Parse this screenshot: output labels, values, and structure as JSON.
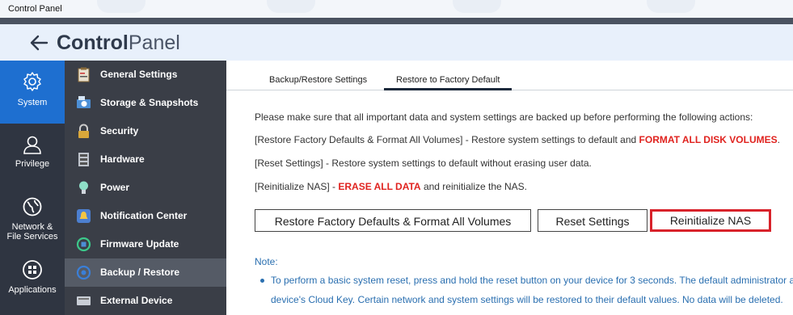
{
  "window": {
    "title": "Control Panel"
  },
  "header": {
    "title_bold": "Control",
    "title_rest": "Panel"
  },
  "rail": [
    {
      "label": "System",
      "icon": "gear-icon",
      "active": true
    },
    {
      "label": "Privilege",
      "icon": "user-icon"
    },
    {
      "label_line1": "Network &",
      "label_line2": "File Services",
      "icon": "globe-icon"
    },
    {
      "label": "Applications",
      "icon": "apps-grid-icon"
    }
  ],
  "submenu": [
    {
      "label": "General Settings",
      "icon": "clipboard-icon"
    },
    {
      "label": "Storage & Snapshots",
      "icon": "storage-icon"
    },
    {
      "label": "Security",
      "icon": "lock-icon"
    },
    {
      "label": "Hardware",
      "icon": "hardware-icon"
    },
    {
      "label": "Power",
      "icon": "bulb-icon"
    },
    {
      "label": "Notification Center",
      "icon": "notification-icon"
    },
    {
      "label": "Firmware Update",
      "icon": "firmware-icon"
    },
    {
      "label": "Backup / Restore",
      "icon": "backup-icon",
      "active": true
    },
    {
      "label": "External Device",
      "icon": "external-device-icon"
    }
  ],
  "tabs": [
    {
      "label": "Backup/Restore Settings"
    },
    {
      "label": "Restore to Factory Default",
      "active": true
    }
  ],
  "content": {
    "intro": "Please make sure that all important data and system settings are backed up before performing the following actions:",
    "line1_a": "[Restore Factory Defaults & Format All Volumes] - Restore system settings to default and ",
    "line1_red": "FORMAT ALL DISK VOLUMES",
    "line1_b": ".",
    "line2": "[Reset Settings] - Restore system settings to default without erasing user data.",
    "line3_a": "[Reinitialize NAS] - ",
    "line3_red": "ERASE ALL DATA",
    "line3_b": " and reinitialize the NAS."
  },
  "buttons": {
    "restore_format": "Restore Factory Defaults & Format All Volumes",
    "reset": "Reset Settings",
    "reinitialize": "Reinitialize NAS"
  },
  "note": {
    "title": "Note:",
    "line1": "To perform a basic system reset, press and hold the reset button on your device for 3 seconds. The default administrator a",
    "line2": "device's Cloud Key. Certain network and system settings will be restored to their default values. No data will be deleted."
  },
  "colors": {
    "accent": "#1e6fd0",
    "danger": "#e0231f",
    "rail_bg": "#2f3541",
    "submenu_bg": "#3a3e47"
  }
}
